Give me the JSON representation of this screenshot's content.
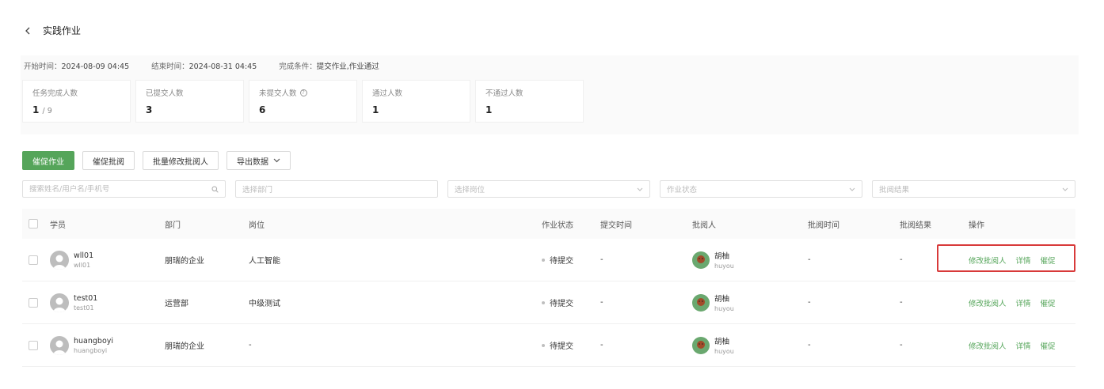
{
  "header": {
    "title": "实践作业"
  },
  "meta": [
    {
      "label": "开始时间：",
      "value": "2024-08-09 04:45"
    },
    {
      "label": "结束时间：",
      "value": "2024-08-31 04:45"
    },
    {
      "label": "完成条件：",
      "value": "提交作业,作业通过"
    }
  ],
  "stats": [
    {
      "label": "任务完成人数",
      "value": "1",
      "total": "/ 9"
    },
    {
      "label": "已提交人数",
      "value": "3",
      "total": ""
    },
    {
      "label": "未提交人数",
      "value": "6",
      "total": "",
      "help": "?"
    },
    {
      "label": "通过人数",
      "value": "1",
      "total": ""
    },
    {
      "label": "不通过人数",
      "value": "1",
      "total": ""
    }
  ],
  "toolbar": {
    "urge_homework": "催促作业",
    "urge_review": "催促批阅",
    "batch_edit_reviewer": "批量修改批阅人",
    "export": "导出数据"
  },
  "filters": {
    "search_placeholder": "搜索姓名/用户名/手机号",
    "department": "选择部门",
    "position": "选择岗位",
    "status": "作业状态",
    "result": "批阅结果"
  },
  "columns": {
    "student": "学员",
    "department": "部门",
    "position": "岗位",
    "status": "作业状态",
    "submit_time": "提交时间",
    "reviewer": "批阅人",
    "review_time": "批阅时间",
    "review_result": "批阅结果",
    "actions": "操作"
  },
  "rows": [
    {
      "name": "wll01",
      "username": "wll01",
      "department": "朋瑞的企业",
      "position": "人工智能",
      "status": "待提交",
      "submit_time": "-",
      "reviewer_name": "胡柚",
      "reviewer_username": "huyou",
      "review_time": "-",
      "review_result": "-",
      "action_edit": "修改批阅人",
      "action_detail": "详情",
      "action_urge": "催促"
    },
    {
      "name": "test01",
      "username": "test01",
      "department": "运营部",
      "position": "中级测试",
      "status": "待提交",
      "submit_time": "-",
      "reviewer_name": "胡柚",
      "reviewer_username": "huyou",
      "review_time": "-",
      "review_result": "-",
      "action_edit": "修改批阅人",
      "action_detail": "详情",
      "action_urge": "催促"
    },
    {
      "name": "huangboyi",
      "username": "huangboyi",
      "department": "朋瑞的企业",
      "position": "-",
      "status": "待提交",
      "submit_time": "-",
      "reviewer_name": "胡柚",
      "reviewer_username": "huyou",
      "review_time": "-",
      "review_result": "-",
      "action_edit": "修改批阅人",
      "action_detail": "详情",
      "action_urge": "催促"
    }
  ],
  "colors": {
    "primary": "#55a55a",
    "highlight": "#d83a3a"
  }
}
